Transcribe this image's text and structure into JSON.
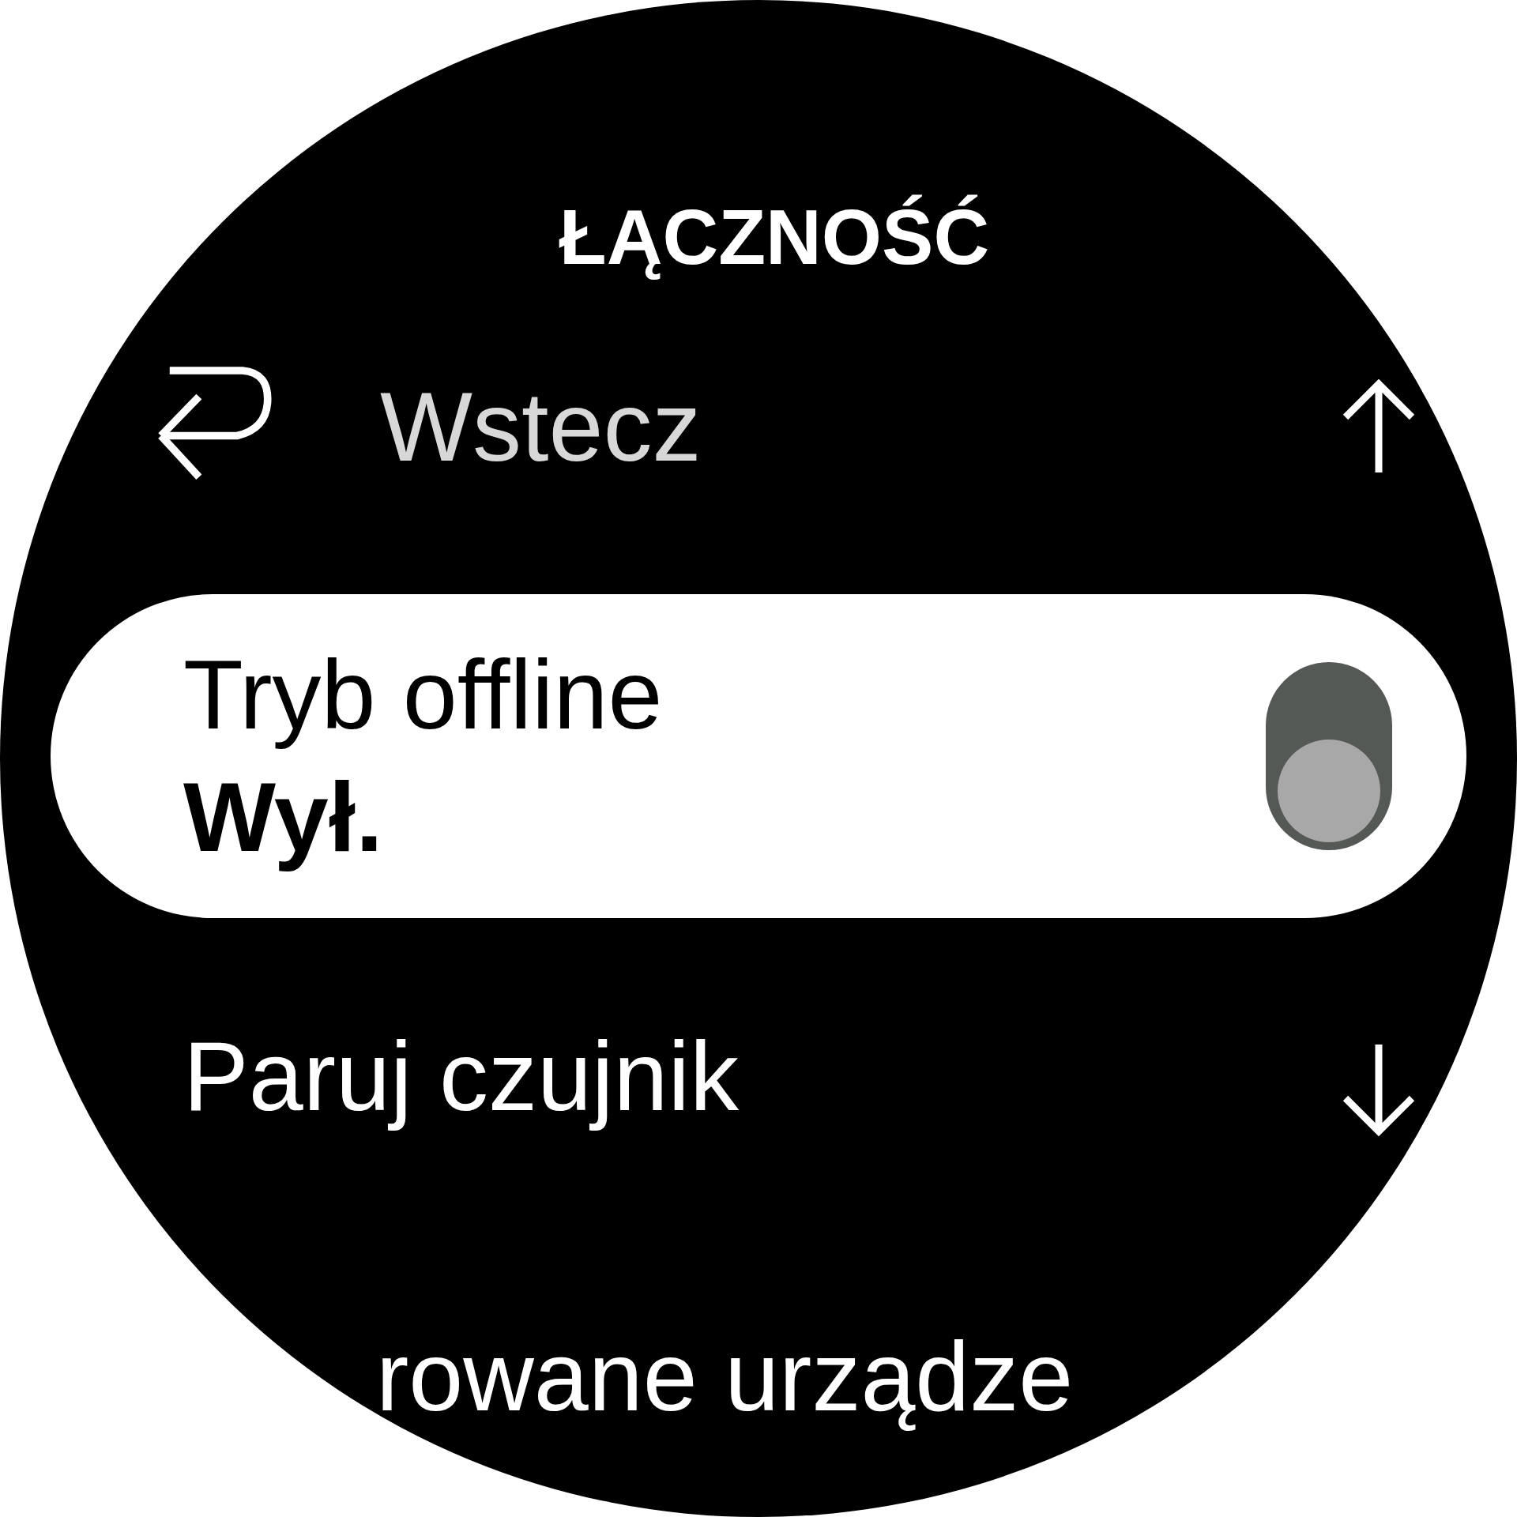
{
  "title": "ŁĄCZNOŚĆ",
  "items": [
    {
      "kind": "back",
      "label": "Wstecz",
      "selected": false
    },
    {
      "kind": "toggle",
      "label": "Tryb offline",
      "value": "Wył.",
      "on": false,
      "selected": true
    },
    {
      "kind": "link",
      "label": "Paruj czujnik",
      "selected": false
    },
    {
      "kind": "link",
      "label": "rowane urządze",
      "selected": false
    }
  ]
}
